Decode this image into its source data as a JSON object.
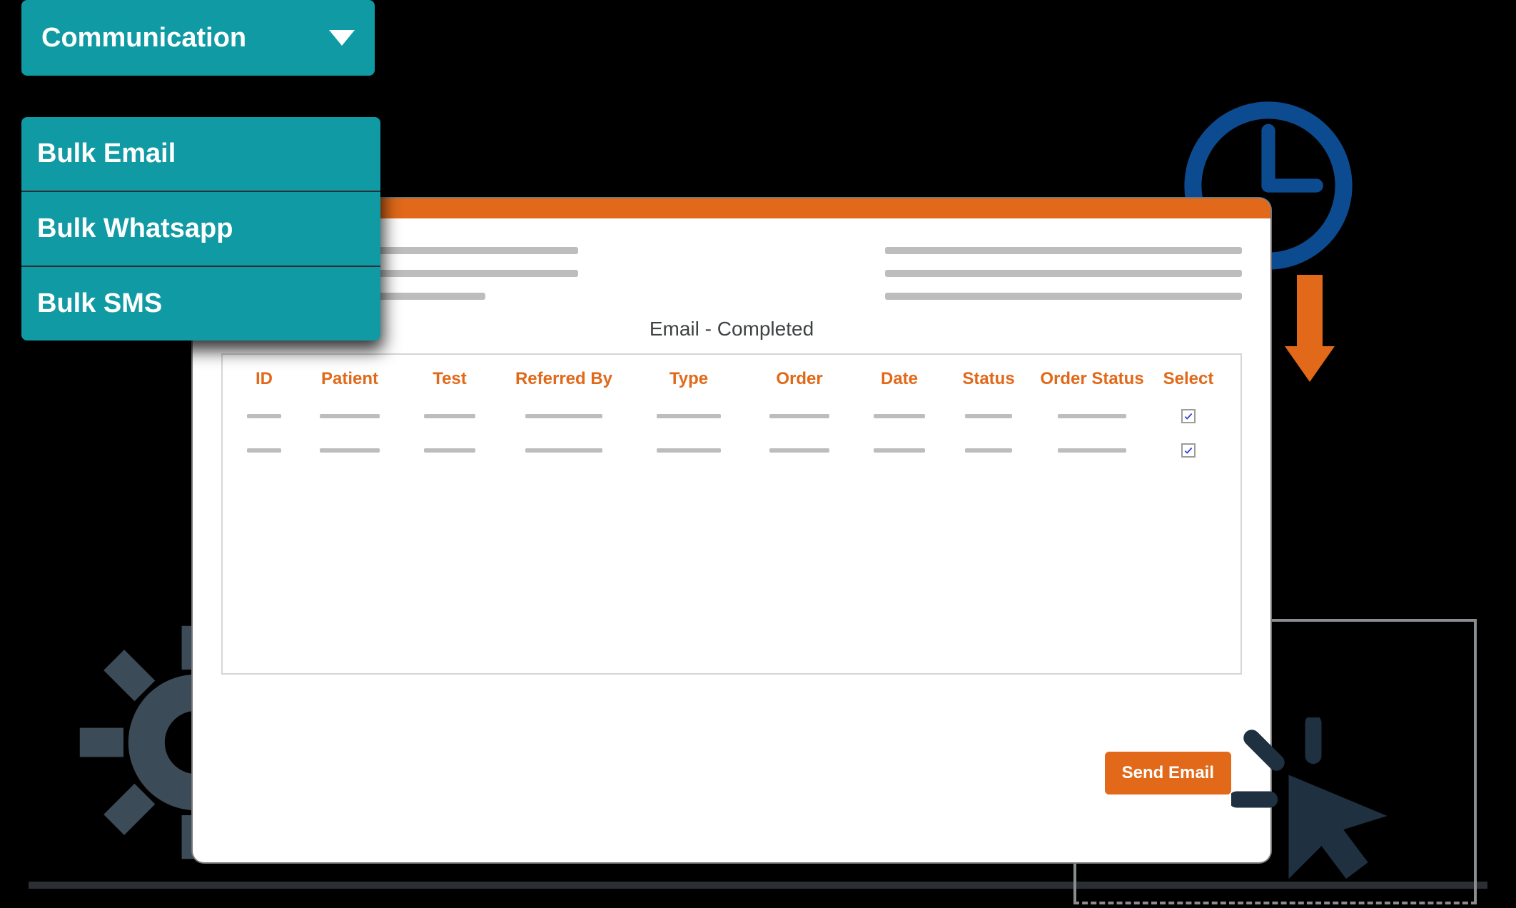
{
  "dropdown": {
    "label": "Communication",
    "items": [
      "Bulk Email",
      "Bulk Whatsapp",
      "Bulk SMS"
    ]
  },
  "section_title": "Email - Completed",
  "table": {
    "headers": [
      "ID",
      "Patient",
      "Test",
      "Referred By",
      "Type",
      "Order",
      "Date",
      "Status",
      "Order Status",
      "Select"
    ],
    "rows": [
      {
        "selected": true
      },
      {
        "selected": true
      }
    ]
  },
  "send_button_label": "Send Email",
  "icons": {
    "gear": "gear-icon",
    "clock": "clock-icon",
    "arrow": "arrow-down-icon",
    "cursor": "cursor-icon",
    "caret": "caret-down-icon",
    "check": "check-icon"
  },
  "colors": {
    "accent_teal": "#109aa4",
    "accent_orange": "#e16919",
    "clock_blue": "#0d4b91",
    "gear_grey": "#3b4b57",
    "cursor_grey": "#1f3040"
  }
}
